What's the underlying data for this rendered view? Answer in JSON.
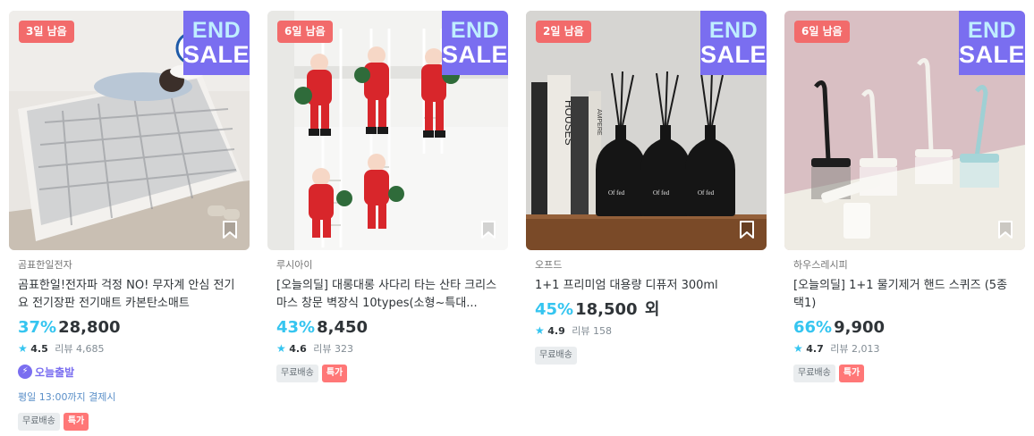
{
  "products": [
    {
      "days_left": "3일 남음",
      "sale_line1": "END",
      "sale_line2": "SALE",
      "brand": "곰표한일전자",
      "title": "곰표한일!전자파 걱정 NO! 무자계 안심 전기요 전기장판 전기매트 카본탄소매트",
      "discount": "37%",
      "price": "28,800",
      "price_suffix": "",
      "rating": "4.5",
      "reviews": "리뷰 4,685",
      "today_label": "오늘출발",
      "deadline": "평일 13:00까지 결제시",
      "badge_free": "무료배송",
      "badge_special": "특가",
      "icons": [
        "bookmark-icon",
        "star-icon",
        "bolt-icon"
      ]
    },
    {
      "days_left": "6일 남음",
      "sale_line1": "END",
      "sale_line2": "SALE",
      "brand": "루시아이",
      "title": "[오늘의딜] 대롱대롱 사다리 타는 산타 크리스마스 창문 벽장식 10types(소형~특대...",
      "discount": "43%",
      "price": "8,450",
      "price_suffix": "",
      "rating": "4.6",
      "reviews": "리뷰 323",
      "badge_free": "무료배송",
      "badge_special": "특가",
      "icons": [
        "bookmark-icon",
        "star-icon"
      ]
    },
    {
      "days_left": "2일 남음",
      "sale_line1": "END",
      "sale_line2": "SALE",
      "brand": "오프드",
      "title": "1+1 프리미엄 대용량 디퓨저 300ml",
      "discount": "45%",
      "price": "18,500",
      "price_suffix": " 외",
      "rating": "4.9",
      "reviews": "리뷰 158",
      "badge_free": "무료배송",
      "bottle_label": "Of fed",
      "book_text_1": "HOUSES",
      "book_text_2": "AMPERE",
      "icons": [
        "bookmark-icon",
        "star-icon"
      ]
    },
    {
      "days_left": "6일 남음",
      "sale_line1": "END",
      "sale_line2": "SALE",
      "brand": "하우스레시피",
      "title": "[오늘의딜] 1+1 물기제거 핸드 스퀴즈 (5종택1)",
      "discount": "66%",
      "price": "9,900",
      "price_suffix": "",
      "rating": "4.7",
      "reviews": "리뷰 2,013",
      "badge_free": "무료배송",
      "badge_special": "특가",
      "icons": [
        "bookmark-icon",
        "star-icon"
      ]
    }
  ],
  "colors": {
    "accent": "#35c5f0",
    "endsale_bg": "#7a6ef0",
    "endsale_top": "#bfeeff",
    "days_badge": "#f26b6b",
    "special_badge": "#ff7777",
    "today_purple": "#7a6ef0",
    "deadline_blue": "#5a8fc8"
  }
}
